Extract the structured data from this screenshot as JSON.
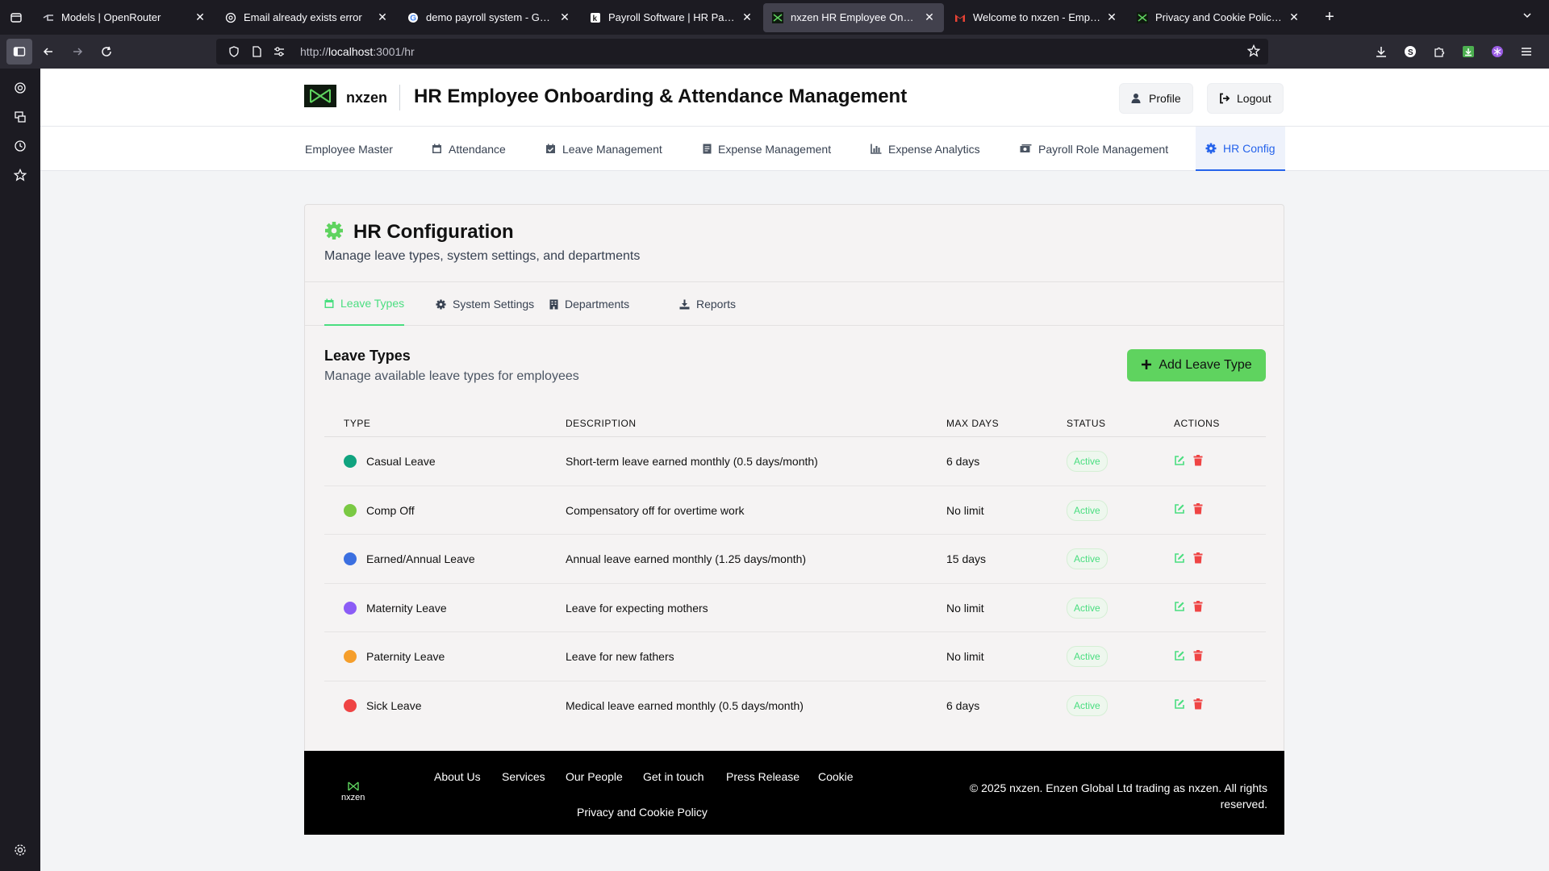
{
  "browser": {
    "tabs": [
      {
        "title": "Models | OpenRouter",
        "active": false
      },
      {
        "title": "Email already exists error",
        "active": false
      },
      {
        "title": "demo payroll system - Google Search",
        "active": false
      },
      {
        "title": "Payroll Software | HR Payroll Management",
        "active": false
      },
      {
        "title": "nxzen HR Employee Onboarding",
        "active": true
      },
      {
        "title": "Welcome to nxzen - Employee Onboarding",
        "active": false
      },
      {
        "title": "Privacy and Cookie Policy | nxzen",
        "active": false
      }
    ],
    "url_prefix": "http://",
    "url_host": "localhost",
    "url_path": ":3001/hr"
  },
  "header": {
    "brand": "nxzen",
    "title": "HR Employee Onboarding & Attendance Management",
    "profile_label": "Profile",
    "logout_label": "Logout"
  },
  "mainnav": {
    "items": [
      {
        "label": "Employee Master",
        "icon": "none"
      },
      {
        "label": "Attendance",
        "icon": "calendar-icon"
      },
      {
        "label": "Leave Management",
        "icon": "calendar-check-icon"
      },
      {
        "label": "Expense Management",
        "icon": "receipt-icon"
      },
      {
        "label": "Expense Analytics",
        "icon": "bar-chart-icon"
      },
      {
        "label": "Payroll Role Management",
        "icon": "money-icon"
      },
      {
        "label": "HR Config",
        "icon": "gear-icon",
        "active": true
      }
    ]
  },
  "card": {
    "title": "HR Configuration",
    "subtitle": "Manage leave types, system settings, and departments",
    "tabs": [
      {
        "label": "Leave Types",
        "active": true
      },
      {
        "label": "System Settings"
      },
      {
        "label": "Departments"
      },
      {
        "label": "Reports"
      }
    ],
    "section_title": "Leave Types",
    "section_subtitle": "Manage available leave types for employees",
    "add_label": "Add Leave Type"
  },
  "table": {
    "headers": [
      "TYPE",
      "DESCRIPTION",
      "MAX DAYS",
      "STATUS",
      "ACTIONS"
    ],
    "rows": [
      {
        "type": "Casual Leave",
        "color": "#10a37f",
        "description": "Short-term leave earned monthly (0.5 days/month)",
        "max_days": "6 days",
        "status": "Active"
      },
      {
        "type": "Comp Off",
        "color": "#7ac943",
        "description": "Compensatory off for overtime work",
        "max_days": "No limit",
        "status": "Active"
      },
      {
        "type": "Earned/Annual Leave",
        "color": "#3b6fe0",
        "description": "Annual leave earned monthly (1.25 days/month)",
        "max_days": "15 days",
        "status": "Active"
      },
      {
        "type": "Maternity Leave",
        "color": "#8b5cf6",
        "description": "Leave for expecting mothers",
        "max_days": "No limit",
        "status": "Active"
      },
      {
        "type": "Paternity Leave",
        "color": "#f59e2b",
        "description": "Leave for new fathers",
        "max_days": "No limit",
        "status": "Active"
      },
      {
        "type": "Sick Leave",
        "color": "#ef4444",
        "description": "Medical leave earned monthly (0.5 days/month)",
        "max_days": "6 days",
        "status": "Active"
      }
    ]
  },
  "footer": {
    "logo_text": "nxzen",
    "links": [
      "About Us",
      "Services",
      "Our People",
      "Get in touch",
      "Press Release",
      "Cookie",
      "Privacy and Cookie Policy"
    ],
    "copyright": "© 2025 nxzen. Enzen Global Ltd trading as nxzen. All rights reserved."
  },
  "colors": {
    "accent_green": "#5fd35f",
    "active_nav_blue": "#2563eb",
    "edit_icon": "#4ade80",
    "delete_icon": "#ef4444"
  }
}
